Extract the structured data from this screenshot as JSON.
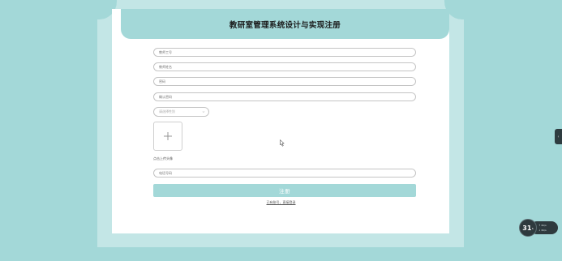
{
  "page": {
    "title": "教研室管理系统设计与实现注册"
  },
  "form": {
    "fields": [
      {
        "name": "teacher-id-field",
        "placeholder": "教师工号"
      },
      {
        "name": "teacher-name-field",
        "placeholder": "教师姓名"
      },
      {
        "name": "password-field",
        "placeholder": "密码"
      },
      {
        "name": "confirm-password-field",
        "placeholder": "确认密码"
      }
    ],
    "gender_select": {
      "selected": "请选择性别"
    },
    "upload": {
      "hint": "点击上传头像",
      "icon": "plus-icon"
    },
    "phone_field": {
      "placeholder": "电话号码"
    },
    "submit_label": "注册",
    "login_link": "已有账号，直接登录"
  },
  "widget": {
    "value": "31",
    "unit": "s",
    "line1": "0k/s",
    "line2": "0k/s"
  },
  "colors": {
    "background": "#a3d8d8",
    "accent": "#a3d8d8",
    "card": "#ffffff"
  }
}
